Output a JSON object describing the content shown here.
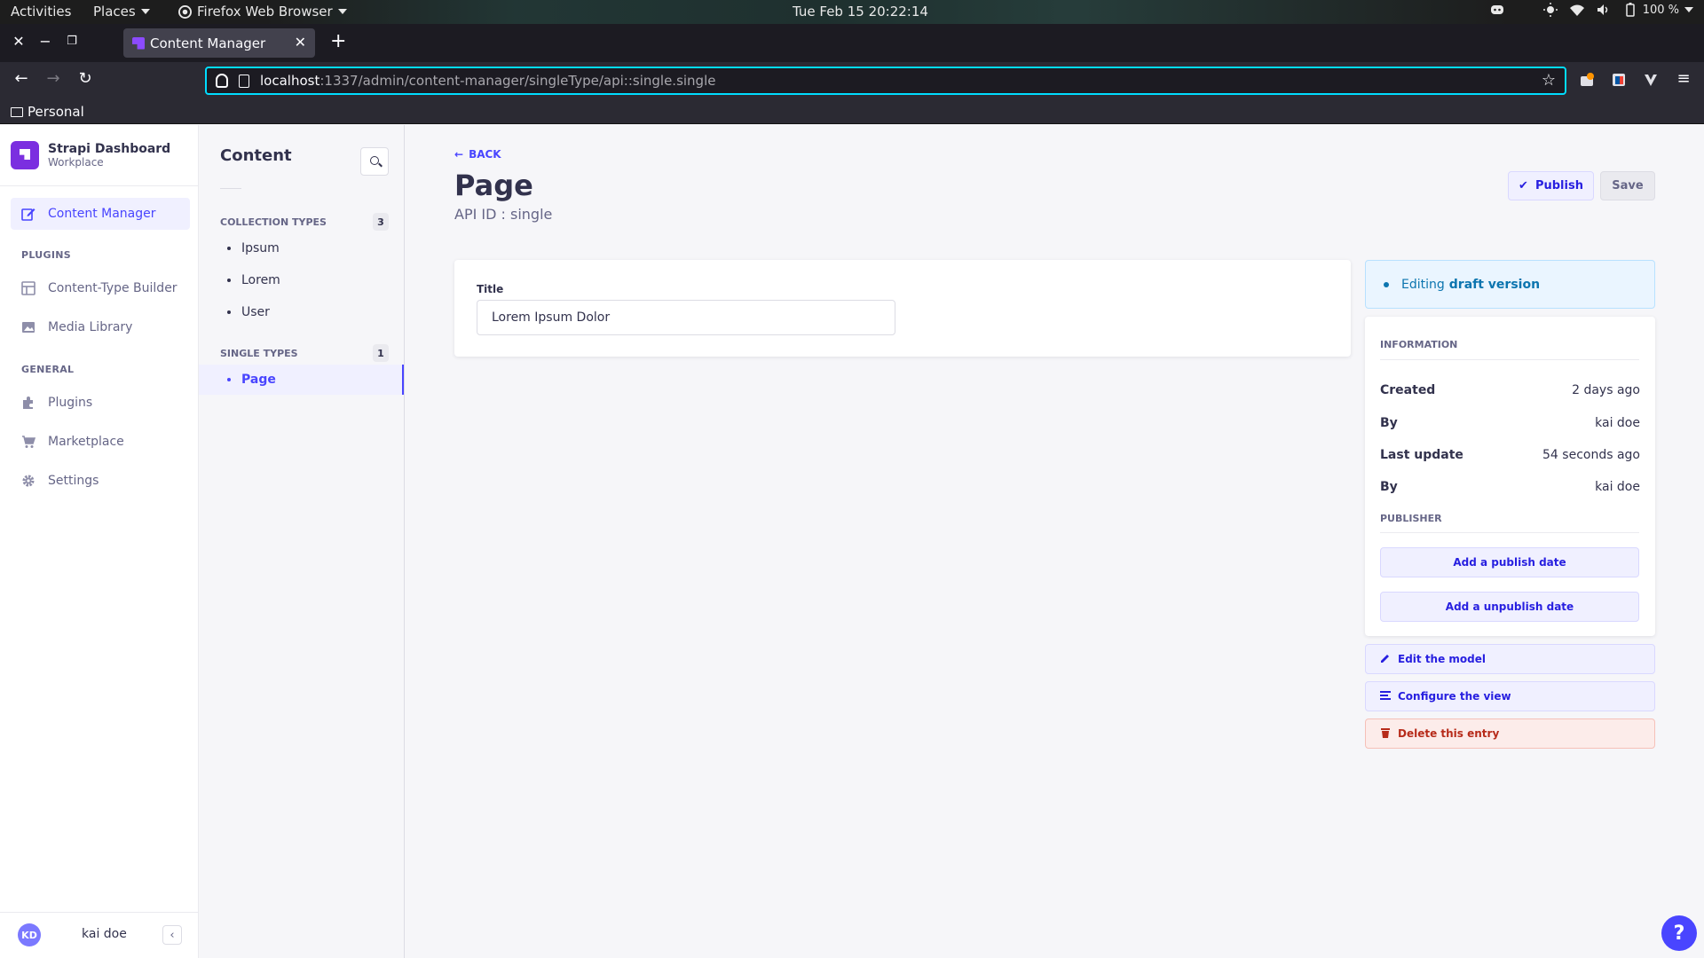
{
  "gnome": {
    "activities": "Activities",
    "places": "Places",
    "browser_menu": "Firefox Web Browser",
    "clock": "Tue Feb 15  20:22:14",
    "battery": "100 %",
    "icons": [
      "discord-icon",
      "brightness-icon",
      "wifi-icon",
      "volume-icon",
      "battery-icon"
    ]
  },
  "browser": {
    "tab_title": "Content Manager",
    "url_host": "localhost",
    "url_rest": ":1337/admin/content-manager/singleType/api::single.single",
    "bookmark_folder": "Personal"
  },
  "brand": {
    "title": "Strapi Dashboard",
    "subtitle": "Workplace",
    "color": "#7b2fe0"
  },
  "nav": {
    "content_manager": "Content Manager",
    "plugins_header": "PLUGINS",
    "content_type_builder": "Content-Type Builder",
    "media_library": "Media Library",
    "general_header": "GENERAL",
    "plugins": "Plugins",
    "marketplace": "Marketplace",
    "settings": "Settings",
    "user_initials": "KD",
    "user_name": "kai doe"
  },
  "subnav": {
    "title": "Content",
    "collection_header": "COLLECTION TYPES",
    "collection_count": "3",
    "collection_items": [
      "Ipsum",
      "Lorem",
      "User"
    ],
    "single_header": "SINGLE TYPES",
    "single_count": "1",
    "single_items": [
      "Page"
    ]
  },
  "main": {
    "back": "BACK",
    "title": "Page",
    "api_id": "API ID : single",
    "publish": "Publish",
    "save": "Save",
    "field_label": "Title",
    "field_value": "Lorem Ipsum Dolor",
    "accent": "#4945ff"
  },
  "sidebar": {
    "editing_prefix": "Editing",
    "editing_version": "draft version",
    "information": "INFORMATION",
    "created_label": "Created",
    "created_value": "2 days ago",
    "by_label": "By",
    "created_by": "kai doe",
    "updated_label": "Last update",
    "updated_value": "54 seconds ago",
    "updated_by": "kai doe",
    "publisher": "PUBLISHER",
    "publish_date": "Add a publish date",
    "unpublish_date": "Add a unpublish date",
    "edit_model": "Edit the model",
    "configure_view": "Configure the view",
    "delete_entry": "Delete this entry"
  },
  "help": "?"
}
